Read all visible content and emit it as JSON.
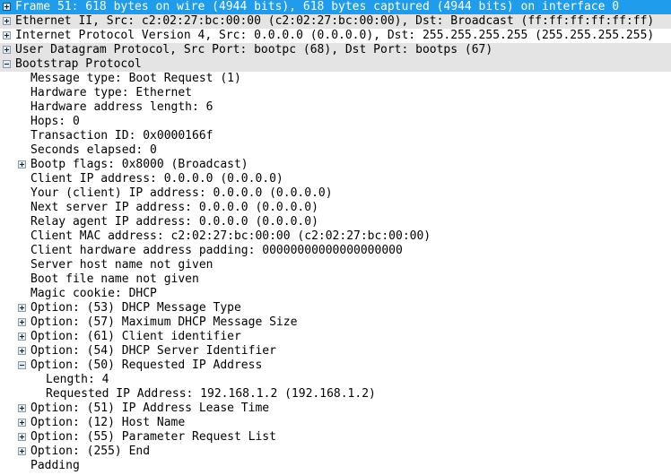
{
  "pane": {
    "name": "packet-details",
    "colors": {
      "selection_bg": "#1f9ceb",
      "selection_fg": "#ffffff",
      "alt_row_bg": "#e4e4e4",
      "row_bg": "#ffffff",
      "text": "#000000"
    }
  },
  "rows": [
    {
      "text": "Frame 51: 618 bytes on wire (4944 bits), 618 bytes captured (4944 bits) on interface 0",
      "depth": 0,
      "icon": "expand-plus-icon",
      "state": "collapsed",
      "selected": true,
      "stripe": false,
      "name": "tree-row-frame"
    },
    {
      "text": "Ethernet II, Src: c2:02:27:bc:00:00 (c2:02:27:bc:00:00), Dst: Broadcast (ff:ff:ff:ff:ff:ff)",
      "depth": 0,
      "icon": "expand-plus-icon",
      "state": "collapsed",
      "selected": false,
      "stripe": true,
      "name": "tree-row-ethernet"
    },
    {
      "text": "Internet Protocol Version 4, Src: 0.0.0.0 (0.0.0.0), Dst: 255.255.255.255 (255.255.255.255)",
      "depth": 0,
      "icon": "expand-plus-icon",
      "state": "collapsed",
      "selected": false,
      "stripe": false,
      "name": "tree-row-ipv4"
    },
    {
      "text": "User Datagram Protocol, Src Port: bootpc (68), Dst Port: bootps (67)",
      "depth": 0,
      "icon": "expand-plus-icon",
      "state": "collapsed",
      "selected": false,
      "stripe": true,
      "name": "tree-row-udp"
    },
    {
      "text": "Bootstrap Protocol",
      "depth": 0,
      "icon": "collapse-minus-icon",
      "state": "expanded",
      "selected": false,
      "stripe": true,
      "name": "tree-row-bootp"
    },
    {
      "text": "Message type: Boot Request (1)",
      "depth": 1,
      "icon": null,
      "state": "leaf",
      "selected": false,
      "stripe": false,
      "name": "tree-row-message-type"
    },
    {
      "text": "Hardware type: Ethernet",
      "depth": 1,
      "icon": null,
      "state": "leaf",
      "selected": false,
      "stripe": false,
      "name": "tree-row-hardware-type"
    },
    {
      "text": "Hardware address length: 6",
      "depth": 1,
      "icon": null,
      "state": "leaf",
      "selected": false,
      "stripe": false,
      "name": "tree-row-hardware-address-length"
    },
    {
      "text": "Hops: 0",
      "depth": 1,
      "icon": null,
      "state": "leaf",
      "selected": false,
      "stripe": false,
      "name": "tree-row-hops"
    },
    {
      "text": "Transaction ID: 0x0000166f",
      "depth": 1,
      "icon": null,
      "state": "leaf",
      "selected": false,
      "stripe": false,
      "name": "tree-row-transaction-id"
    },
    {
      "text": "Seconds elapsed: 0",
      "depth": 1,
      "icon": null,
      "state": "leaf",
      "selected": false,
      "stripe": false,
      "name": "tree-row-seconds-elapsed"
    },
    {
      "text": "Bootp flags: 0x8000 (Broadcast)",
      "depth": 1,
      "icon": "expand-plus-icon",
      "state": "collapsed",
      "selected": false,
      "stripe": false,
      "name": "tree-row-bootp-flags"
    },
    {
      "text": "Client IP address: 0.0.0.0 (0.0.0.0)",
      "depth": 1,
      "icon": null,
      "state": "leaf",
      "selected": false,
      "stripe": false,
      "name": "tree-row-client-ip-address"
    },
    {
      "text": "Your (client) IP address: 0.0.0.0 (0.0.0.0)",
      "depth": 1,
      "icon": null,
      "state": "leaf",
      "selected": false,
      "stripe": false,
      "name": "tree-row-your-client-ip-address"
    },
    {
      "text": "Next server IP address: 0.0.0.0 (0.0.0.0)",
      "depth": 1,
      "icon": null,
      "state": "leaf",
      "selected": false,
      "stripe": false,
      "name": "tree-row-next-server-ip-address"
    },
    {
      "text": "Relay agent IP address: 0.0.0.0 (0.0.0.0)",
      "depth": 1,
      "icon": null,
      "state": "leaf",
      "selected": false,
      "stripe": false,
      "name": "tree-row-relay-agent-ip-address"
    },
    {
      "text": "Client MAC address: c2:02:27:bc:00:00 (c2:02:27:bc:00:00)",
      "depth": 1,
      "icon": null,
      "state": "leaf",
      "selected": false,
      "stripe": false,
      "name": "tree-row-client-mac-address"
    },
    {
      "text": "Client hardware address padding: 00000000000000000000",
      "depth": 1,
      "icon": null,
      "state": "leaf",
      "selected": false,
      "stripe": false,
      "name": "tree-row-client-hardware-address-padding"
    },
    {
      "text": "Server host name not given",
      "depth": 1,
      "icon": null,
      "state": "leaf",
      "selected": false,
      "stripe": false,
      "name": "tree-row-server-host-name"
    },
    {
      "text": "Boot file name not given",
      "depth": 1,
      "icon": null,
      "state": "leaf",
      "selected": false,
      "stripe": false,
      "name": "tree-row-boot-file-name"
    },
    {
      "text": "Magic cookie: DHCP",
      "depth": 1,
      "icon": null,
      "state": "leaf",
      "selected": false,
      "stripe": false,
      "name": "tree-row-magic-cookie"
    },
    {
      "text": "Option: (53) DHCP Message Type",
      "depth": 1,
      "icon": "expand-plus-icon",
      "state": "collapsed",
      "selected": false,
      "stripe": false,
      "name": "tree-row-option-53"
    },
    {
      "text": "Option: (57) Maximum DHCP Message Size",
      "depth": 1,
      "icon": "expand-plus-icon",
      "state": "collapsed",
      "selected": false,
      "stripe": false,
      "name": "tree-row-option-57"
    },
    {
      "text": "Option: (61) Client identifier",
      "depth": 1,
      "icon": "expand-plus-icon",
      "state": "collapsed",
      "selected": false,
      "stripe": false,
      "name": "tree-row-option-61"
    },
    {
      "text": "Option: (54) DHCP Server Identifier",
      "depth": 1,
      "icon": "expand-plus-icon",
      "state": "collapsed",
      "selected": false,
      "stripe": false,
      "name": "tree-row-option-54"
    },
    {
      "text": "Option: (50) Requested IP Address",
      "depth": 1,
      "icon": "collapse-minus-icon",
      "state": "expanded",
      "selected": false,
      "stripe": false,
      "name": "tree-row-option-50"
    },
    {
      "text": "Length: 4",
      "depth": 2,
      "icon": null,
      "state": "leaf",
      "selected": false,
      "stripe": false,
      "name": "tree-row-option-50-length"
    },
    {
      "text": "Requested IP Address: 192.168.1.2 (192.168.1.2)",
      "depth": 2,
      "icon": null,
      "state": "leaf",
      "selected": false,
      "stripe": false,
      "name": "tree-row-option-50-value"
    },
    {
      "text": "Option: (51) IP Address Lease Time",
      "depth": 1,
      "icon": "expand-plus-icon",
      "state": "collapsed",
      "selected": false,
      "stripe": false,
      "name": "tree-row-option-51"
    },
    {
      "text": "Option: (12) Host Name",
      "depth": 1,
      "icon": "expand-plus-icon",
      "state": "collapsed",
      "selected": false,
      "stripe": false,
      "name": "tree-row-option-12"
    },
    {
      "text": "Option: (55) Parameter Request List",
      "depth": 1,
      "icon": "expand-plus-icon",
      "state": "collapsed",
      "selected": false,
      "stripe": false,
      "name": "tree-row-option-55"
    },
    {
      "text": "Option: (255) End",
      "depth": 1,
      "icon": "expand-plus-icon",
      "state": "collapsed",
      "selected": false,
      "stripe": false,
      "name": "tree-row-option-255"
    },
    {
      "text": "Padding",
      "depth": 1,
      "icon": null,
      "state": "leaf",
      "selected": false,
      "stripe": false,
      "name": "tree-row-padding"
    }
  ]
}
